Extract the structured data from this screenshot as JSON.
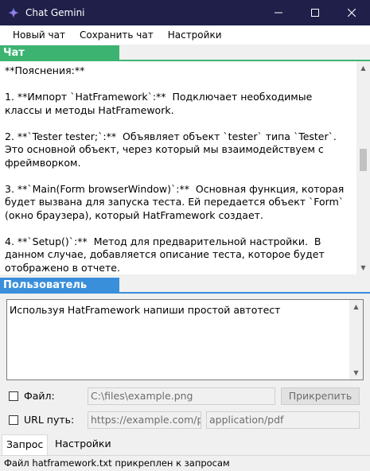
{
  "window": {
    "title": "Chat Gemini",
    "icon": "gemini-star-icon",
    "controls": [
      "minimize-icon",
      "maximize-icon",
      "close-icon"
    ]
  },
  "menu": {
    "new_chat": "Новый чат",
    "save_chat": "Сохранить чат",
    "settings": "Настройки"
  },
  "chat": {
    "header": "Чат",
    "accent_color": "#3cb371",
    "lines": [
      "**Пояснения:**",
      "",
      "1. **Импорт `HatFramework`:**  Подключает необходимые классы и методы HatFramework.",
      "",
      "2. **`Tester tester;`:**  Объявляет объект `tester` типа `Tester`. Это основной объект, через который мы взаимодействуем с фреймворком.",
      "",
      "3. **`Main(Form browserWindow)`:**  Основная функция, которая будет вызвана для запуска теста. Ей передается объект `Form` (окно браузера), который HatFramework создает.",
      "",
      "4. **`Setup()`:**  Метод для предварительной настройки.  В данном случае, добавляется описание теста, которое будет отображено в отчете."
    ],
    "scroll_position": 0.45
  },
  "user": {
    "header": "Пользователь",
    "accent_color": "#3a8fdb",
    "message": "Используя HatFramework напиши простой автотест"
  },
  "file_row": {
    "label": "Файл:",
    "path": "C:\\files\\example.png",
    "attach_button": "Прикрепить"
  },
  "url_row": {
    "label": "URL путь:",
    "url": "https://example.com/page",
    "mime": "application/pdf"
  },
  "tabs": {
    "request": "Запрос",
    "settings": "Настройки"
  },
  "status": {
    "text": "Файл hatframework.txt прикреплен к запросам"
  }
}
